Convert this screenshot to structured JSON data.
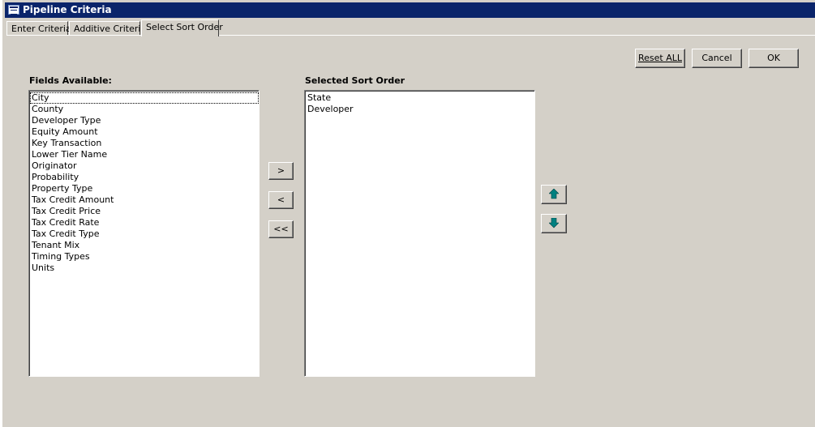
{
  "window": {
    "title": "Pipeline Criteria"
  },
  "tabs": [
    {
      "label": "Enter Criteria"
    },
    {
      "label": "Additive Criteria"
    },
    {
      "label": "Select Sort Order"
    }
  ],
  "actions": {
    "reset_label": "Reset ALL",
    "cancel_label": "Cancel",
    "ok_label": "OK"
  },
  "fields_available": {
    "label": "Fields Available:",
    "items": [
      "City",
      "County",
      "Developer Type",
      "Equity Amount",
      "Key Transaction",
      "Lower Tier Name",
      "Originator",
      "Probability",
      "Property Type",
      "Tax Credit Amount",
      "Tax Credit Price",
      "Tax Credit Rate",
      "Tax Credit Type",
      "Tenant Mix",
      "Timing Types",
      "Units"
    ]
  },
  "transfer": {
    "add_label": ">",
    "remove_label": "<",
    "remove_all_label": "<<"
  },
  "selected_sort_order": {
    "label": "Selected Sort Order",
    "items": [
      "State",
      "Developer"
    ]
  },
  "reorder": {
    "up_icon": "arrow-up-icon",
    "down_icon": "arrow-down-icon",
    "icon_color": "#008080"
  }
}
